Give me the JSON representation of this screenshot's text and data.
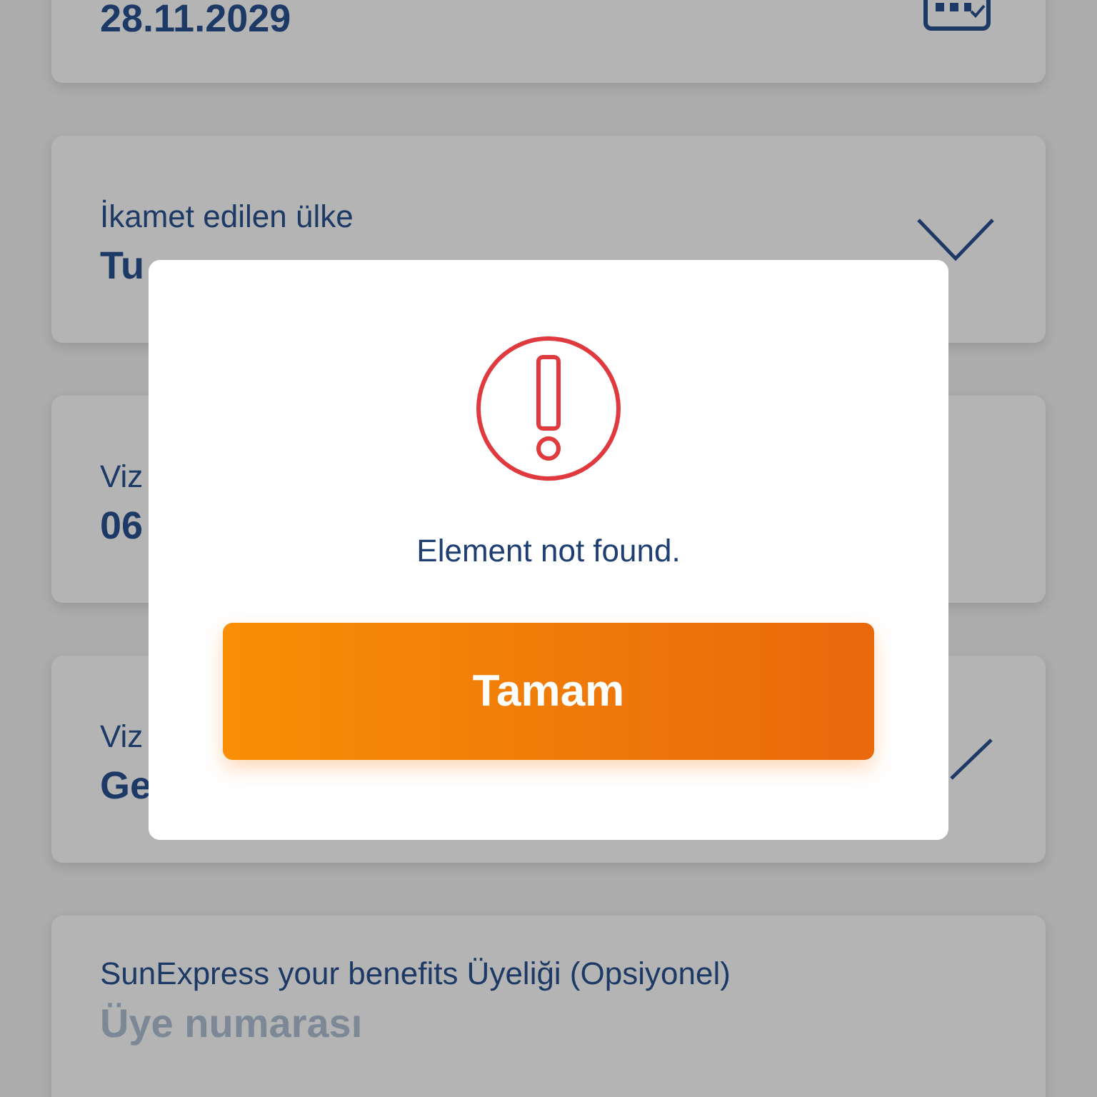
{
  "form": {
    "fields": [
      {
        "kind": "date",
        "value": "28.11.2029"
      },
      {
        "kind": "select",
        "label": "İkamet edilen ülke",
        "value": "Tu"
      },
      {
        "kind": "text",
        "label": "Viz",
        "value": "06"
      },
      {
        "kind": "select_partial",
        "label": "Viz",
        "value": "Ge"
      },
      {
        "kind": "input",
        "label": "SunExpress your benefits Üyeliği (Opsiyonel)",
        "placeholder": "Üye numarası"
      }
    ]
  },
  "dialog": {
    "message": "Element not found.",
    "button": "Tamam"
  }
}
